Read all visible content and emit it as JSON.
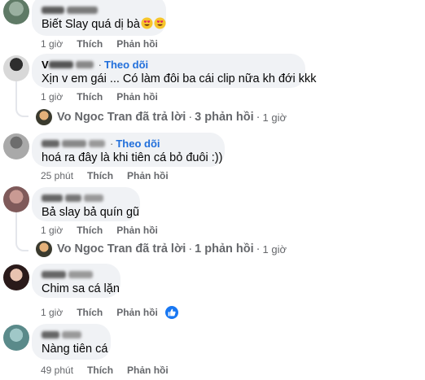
{
  "comments": [
    {
      "text": "Biết Slay quá dị bà",
      "emojis": [
        "heart-eyes-emoji",
        "heart-eyes-emoji"
      ],
      "actions": {
        "time": "1 giờ",
        "like": "Thích",
        "reply": "Phản hồi"
      }
    },
    {
      "author_suffix": "Theo dõi",
      "text": "Xịn v em gái ... Có làm đôi ba cái clip nữa kh đới kkk",
      "actions": {
        "time": "1 giờ",
        "like": "Thích",
        "reply": "Phản hồi"
      },
      "replies": {
        "name": "Vo Ngoc Tran",
        "verb": "đã trả lời",
        "count": "3 phản hồi",
        "time": "1 giờ",
        "separator": "·"
      }
    },
    {
      "author_suffix": "Theo dõi",
      "text": "hoá ra đây là khi tiên cá bỏ đuôi :))",
      "actions": {
        "time": "25 phút",
        "like": "Thích",
        "reply": "Phản hồi"
      }
    },
    {
      "text": "Bả slay bả quín gũ",
      "actions": {
        "time": "1 giờ",
        "like": "Thích",
        "reply": "Phản hồi"
      },
      "replies": {
        "name": "Vo Ngoc Tran",
        "verb": "đã trả lời",
        "count": "1 phản hồi",
        "time": "1 giờ",
        "separator": "·"
      }
    },
    {
      "text": "Chim sa cá lặn",
      "actions": {
        "time": "1 giờ",
        "like": "Thích",
        "reply": "Phản hồi"
      },
      "reaction": "like-icon"
    },
    {
      "text": "Nàng tiên cá",
      "actions": {
        "time": "49 phút",
        "like": "Thích",
        "reply": "Phản hồi"
      }
    }
  ],
  "separator": "·",
  "colors": {
    "bubble": "#f0f2f5",
    "link": "#216fdb",
    "meta": "#65676b",
    "like": "#1877f2"
  }
}
